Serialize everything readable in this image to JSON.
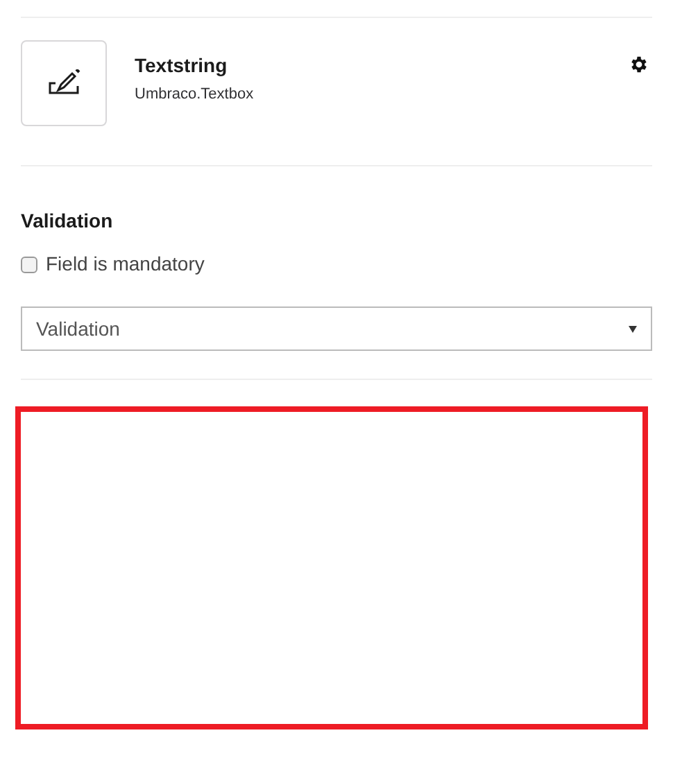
{
  "property": {
    "title": "Textstring",
    "editor": "Umbraco.Textbox"
  },
  "validation": {
    "heading": "Validation",
    "mandatory": {
      "label": "Field is mandatory",
      "checked": false
    },
    "select": {
      "value": "Validation"
    }
  },
  "highlight": {
    "kind": "frame"
  }
}
